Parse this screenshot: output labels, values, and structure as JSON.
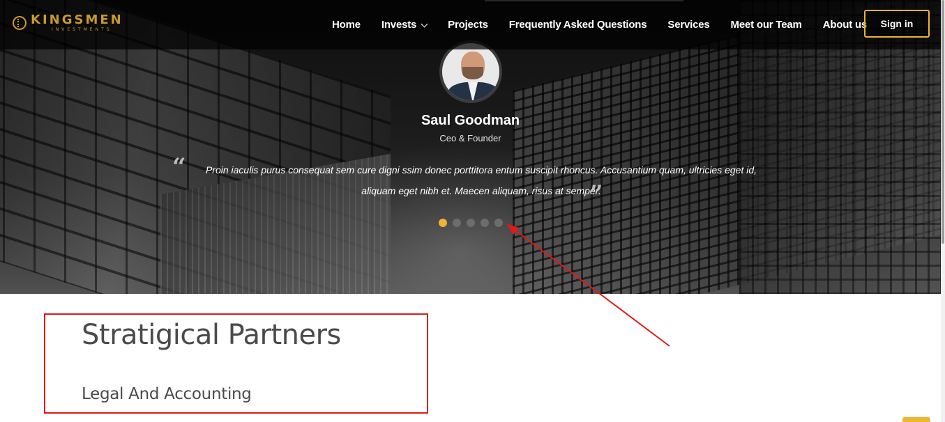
{
  "brand": {
    "name": "KINGSMEN",
    "tagline": "INVESTMENTS",
    "color": "#c99a2e"
  },
  "nav": {
    "items": [
      {
        "label": "Home"
      },
      {
        "label": "Invests"
      },
      {
        "label": "Projects"
      },
      {
        "label": "Frequently Asked Questions"
      },
      {
        "label": "Services"
      },
      {
        "label": "Meet our Team"
      },
      {
        "label": "About us"
      }
    ],
    "signin_label": "Sign in",
    "accent": "#f0b432"
  },
  "testimonial": {
    "name": "Saul Goodman",
    "role": "Ceo & Founder",
    "quote_open": "“",
    "quote_close": "”",
    "quote": "Proin iaculis purus consequat sem cure digni ssim donec porttitora entum suscipit rhoncus. Accusantium quam, ultricies eget id, aliquam eget nibh et. Maecen aliquam, risus at semper.",
    "slides_total": 5,
    "active_slide": 1
  },
  "partners": {
    "title": "Stratigical Partners",
    "subtitle": "Legal And Accounting"
  },
  "annotation": {
    "color": "#e01919"
  }
}
